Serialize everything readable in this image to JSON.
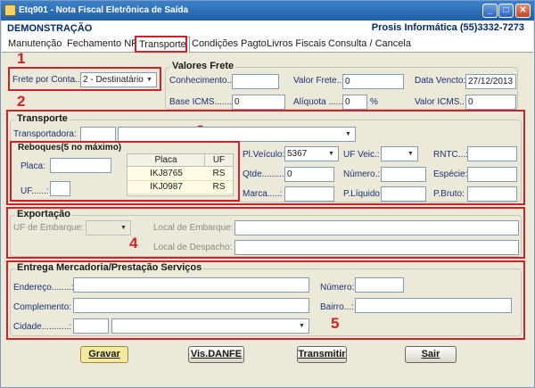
{
  "window": {
    "title": "Etq901 - Nota Fiscal Eletrônica de Saída"
  },
  "header": {
    "left": "DEMONSTRAÇÃO",
    "right": "Prosis Informática (55)3332-7273"
  },
  "tabs": [
    "Manutenção",
    "Fechamento NF",
    "Transporte",
    "Condições Pagto",
    "Livros Fiscais",
    "Consulta / Cancela"
  ],
  "annotations": [
    "1",
    "2",
    "3",
    "4",
    "5"
  ],
  "frete": {
    "label": "Frete por Conta..:",
    "value": "2 - Destinatário"
  },
  "valores": {
    "title": "Valores Frete",
    "conhecimento": "Conhecimento..:",
    "valor_frete": "Valor Frete..:",
    "valor_frete_value": "0",
    "data_vencto": "Data Vencto:",
    "data_vencto_value": "27/12/2013",
    "base_icms": "Base  ICMS.......:",
    "base_icms_value": "0",
    "aliquota": "Alíquota ......:",
    "aliquota_value": "0",
    "percent": "%",
    "valor_icms": "Valor ICMS..:",
    "valor_icms_value": "0"
  },
  "transporte": {
    "title": "Transporte",
    "transportadora": "Transportadora:",
    "reboques_title": "Reboques(5 no máximo)",
    "placa": "Placa:",
    "uf": "UF......:",
    "table_headers": [
      "Placa",
      "UF"
    ],
    "table_rows": [
      [
        "IKJ8765",
        "RS"
      ],
      [
        "IKJ0987",
        "RS"
      ]
    ],
    "pl_veiculo": "Pl.Veículo:",
    "pl_veiculo_value": "5367",
    "uf_veic": "UF Veic.:",
    "rntc": "RNTC...:",
    "qtde": "Qtde.........:",
    "qtde_value": "0",
    "numero": "Número.:",
    "especie": "Espécie:",
    "marca": "Marca.....:",
    "p_liquido": "P.Líquido:",
    "p_bruto": "P.Bruto:"
  },
  "exportacao": {
    "title": "Exportação",
    "uf_embarque": "UF de Embarque:",
    "local_embarque": "Local de Embarque:",
    "local_despacho": "Local de Despacho:"
  },
  "entrega": {
    "title": "Entrega Mercadoria/Prestação Serviços",
    "endereco": "Endereço........:",
    "numero": "Número:",
    "complemento": "Complemento:",
    "bairro": "Bairro...:",
    "cidade": "Cidade...........:"
  },
  "buttons": {
    "gravar": "Gravar",
    "danfe": "Vis.DANFE",
    "transmitir": "Transmitir",
    "sair": "Sair"
  },
  "colors": {
    "annotation": "#d0202a",
    "label": "#16327a",
    "titlebar": "#1f5fa6"
  }
}
